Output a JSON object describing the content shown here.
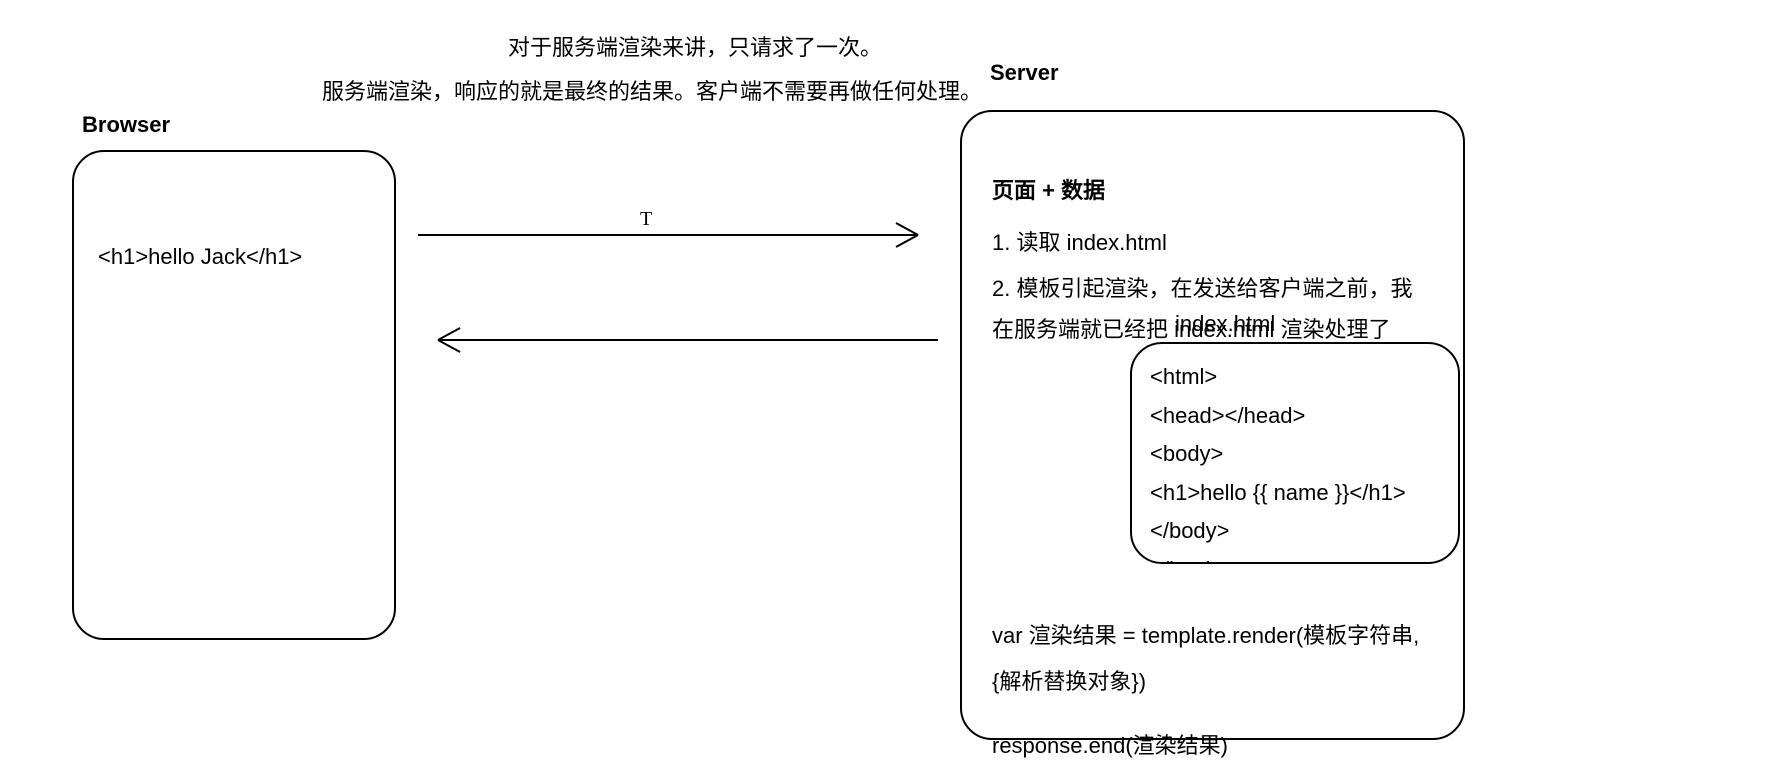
{
  "captions": {
    "line1": "对于服务端渲染来讲，只请求了一次。",
    "line2": "服务端渲染，响应的就是最终的结果。客户端不需要再做任何处理。"
  },
  "browser": {
    "label": "Browser",
    "content": "<h1>hello Jack</h1>"
  },
  "server": {
    "label": "Server",
    "heading": "页面 + 数据",
    "step1": "1. 读取 index.html",
    "step2": "2. 模板引起渲染，在发送给客户端之前，我在服务端就已经把 index.html 渲染处理了",
    "render_call_1": "var 渲染结果 = template.render(模板字符串,",
    "render_call_2": "{解析替换对象})",
    "response": "response.end(渲染结果)"
  },
  "index_file": {
    "label": "index.html",
    "l1": "<html>",
    "l2": "<head></head>",
    "l3": "<body>",
    "l4": "<h1>hello {{ name }}</h1>",
    "l5": "</body>",
    "l6": "</html>"
  },
  "arrows": {
    "caret": "T"
  }
}
